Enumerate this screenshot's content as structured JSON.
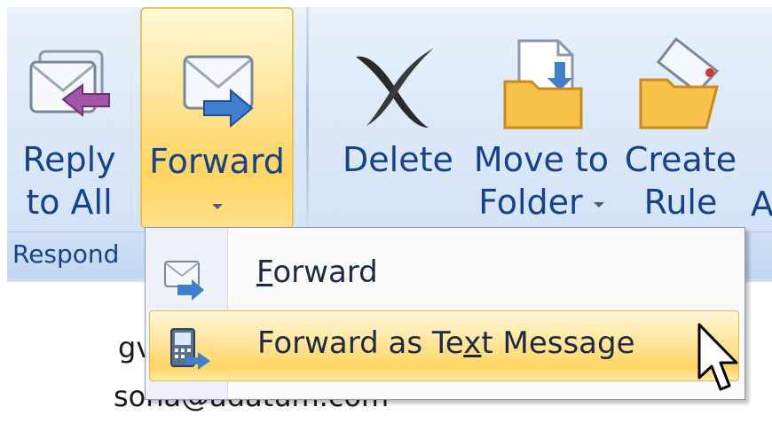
{
  "ribbon": {
    "buttons": [
      {
        "name": "reply-to-all",
        "line1": "Reply",
        "line2": "to All"
      },
      {
        "name": "forward",
        "line1": "Forward"
      },
      {
        "name": "delete",
        "line1": "Delete"
      },
      {
        "name": "move-to-folder",
        "line1": "Move to",
        "line2": "Folder"
      },
      {
        "name": "create-rule",
        "line1": "Create",
        "line2": "Rule"
      }
    ],
    "overflow_letter": "A",
    "group_label": "Respond"
  },
  "menu": {
    "items": [
      {
        "label_pre": "",
        "label_u": "F",
        "label_post": "orward"
      },
      {
        "label_pre": "Forward as Te",
        "label_u": "x",
        "label_post": "t Message"
      }
    ]
  },
  "content": {
    "partial_text": "gv",
    "email": "soha@adatum.com"
  },
  "colors": {
    "ribbon_text": "#15428b",
    "highlight": "#ffd35f"
  }
}
